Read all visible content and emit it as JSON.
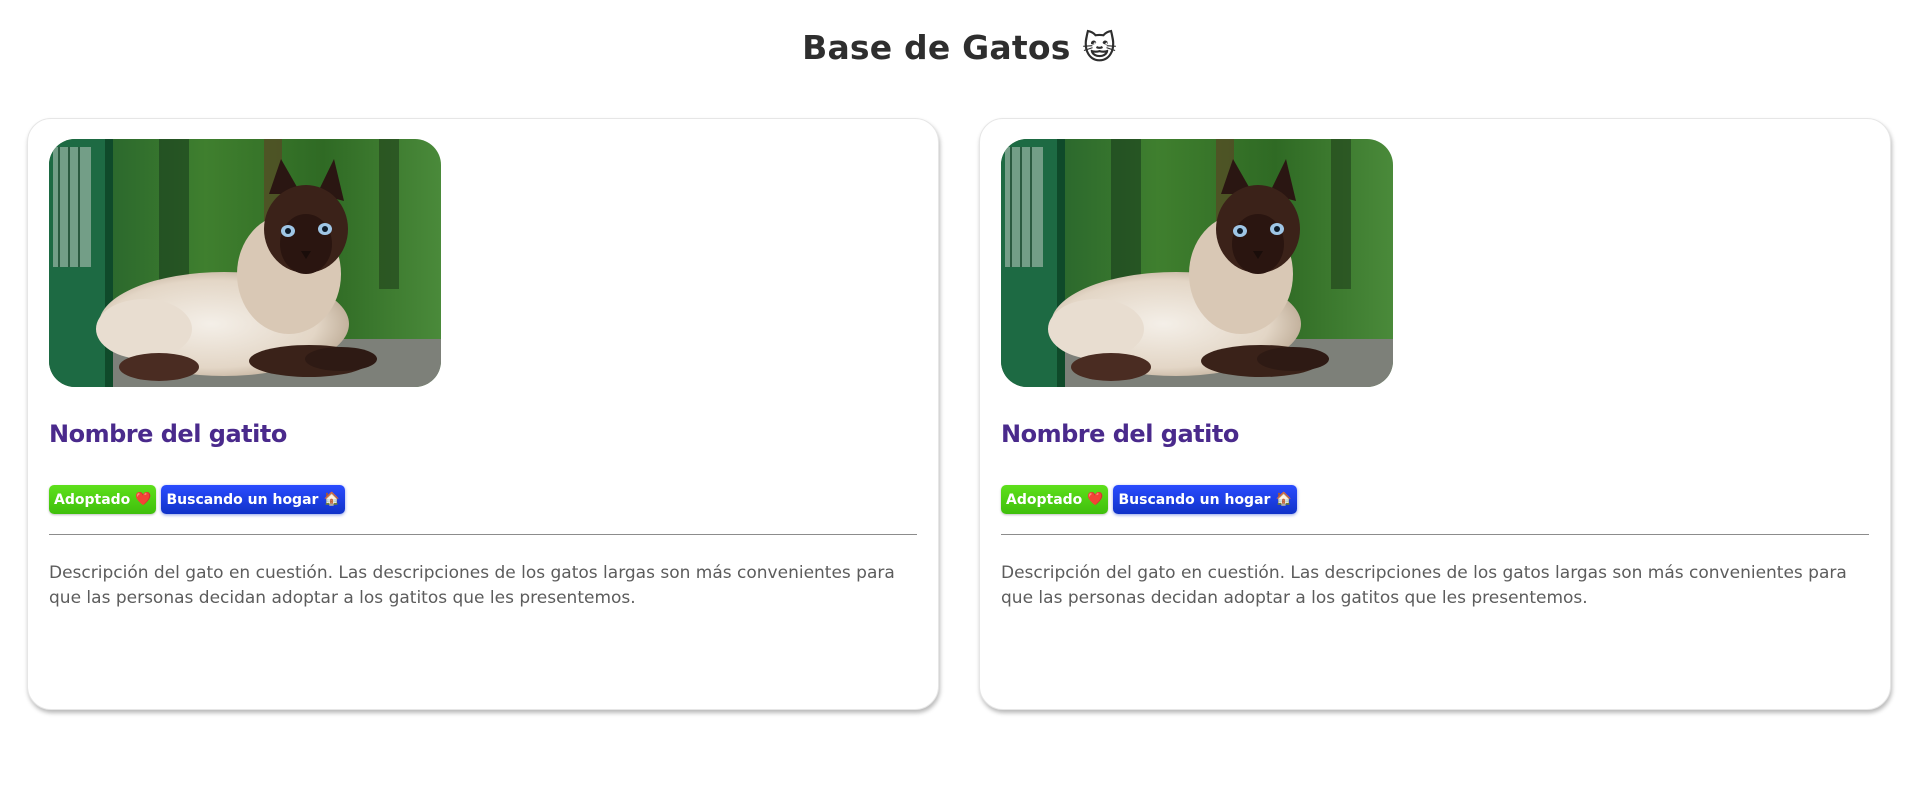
{
  "page": {
    "title": "Base de Gatos 😺"
  },
  "cards": [
    {
      "photo": "siamese-cat-photo",
      "name": "Nombre del gatito",
      "badges": {
        "adopted": "Adoptado",
        "adopted_emoji": "❤️",
        "searching": "Buscando un hogar",
        "searching_emoji": "🏠"
      },
      "description": "Descripción del gato en cuestión. Las descripciones de los gatos largas son más convenientes para que las personas decidan adoptar a los gatitos que les presentemos."
    },
    {
      "photo": "siamese-cat-photo",
      "name": "Nombre del gatito",
      "badges": {
        "adopted": "Adoptado",
        "adopted_emoji": "❤️",
        "searching": "Buscando un hogar",
        "searching_emoji": "🏠"
      },
      "description": "Descripción del gato en cuestión. Las descripciones de los gatos largas son más convenientes para que las personas decidan adoptar a los gatitos que les presentemos."
    }
  ],
  "colors": {
    "title": "#2e2e2e",
    "cat_name": "#4a2a8c",
    "adopted_badge": "#4fd013",
    "searching_badge": "#1a3ee8",
    "description": "#5c5c5c"
  }
}
